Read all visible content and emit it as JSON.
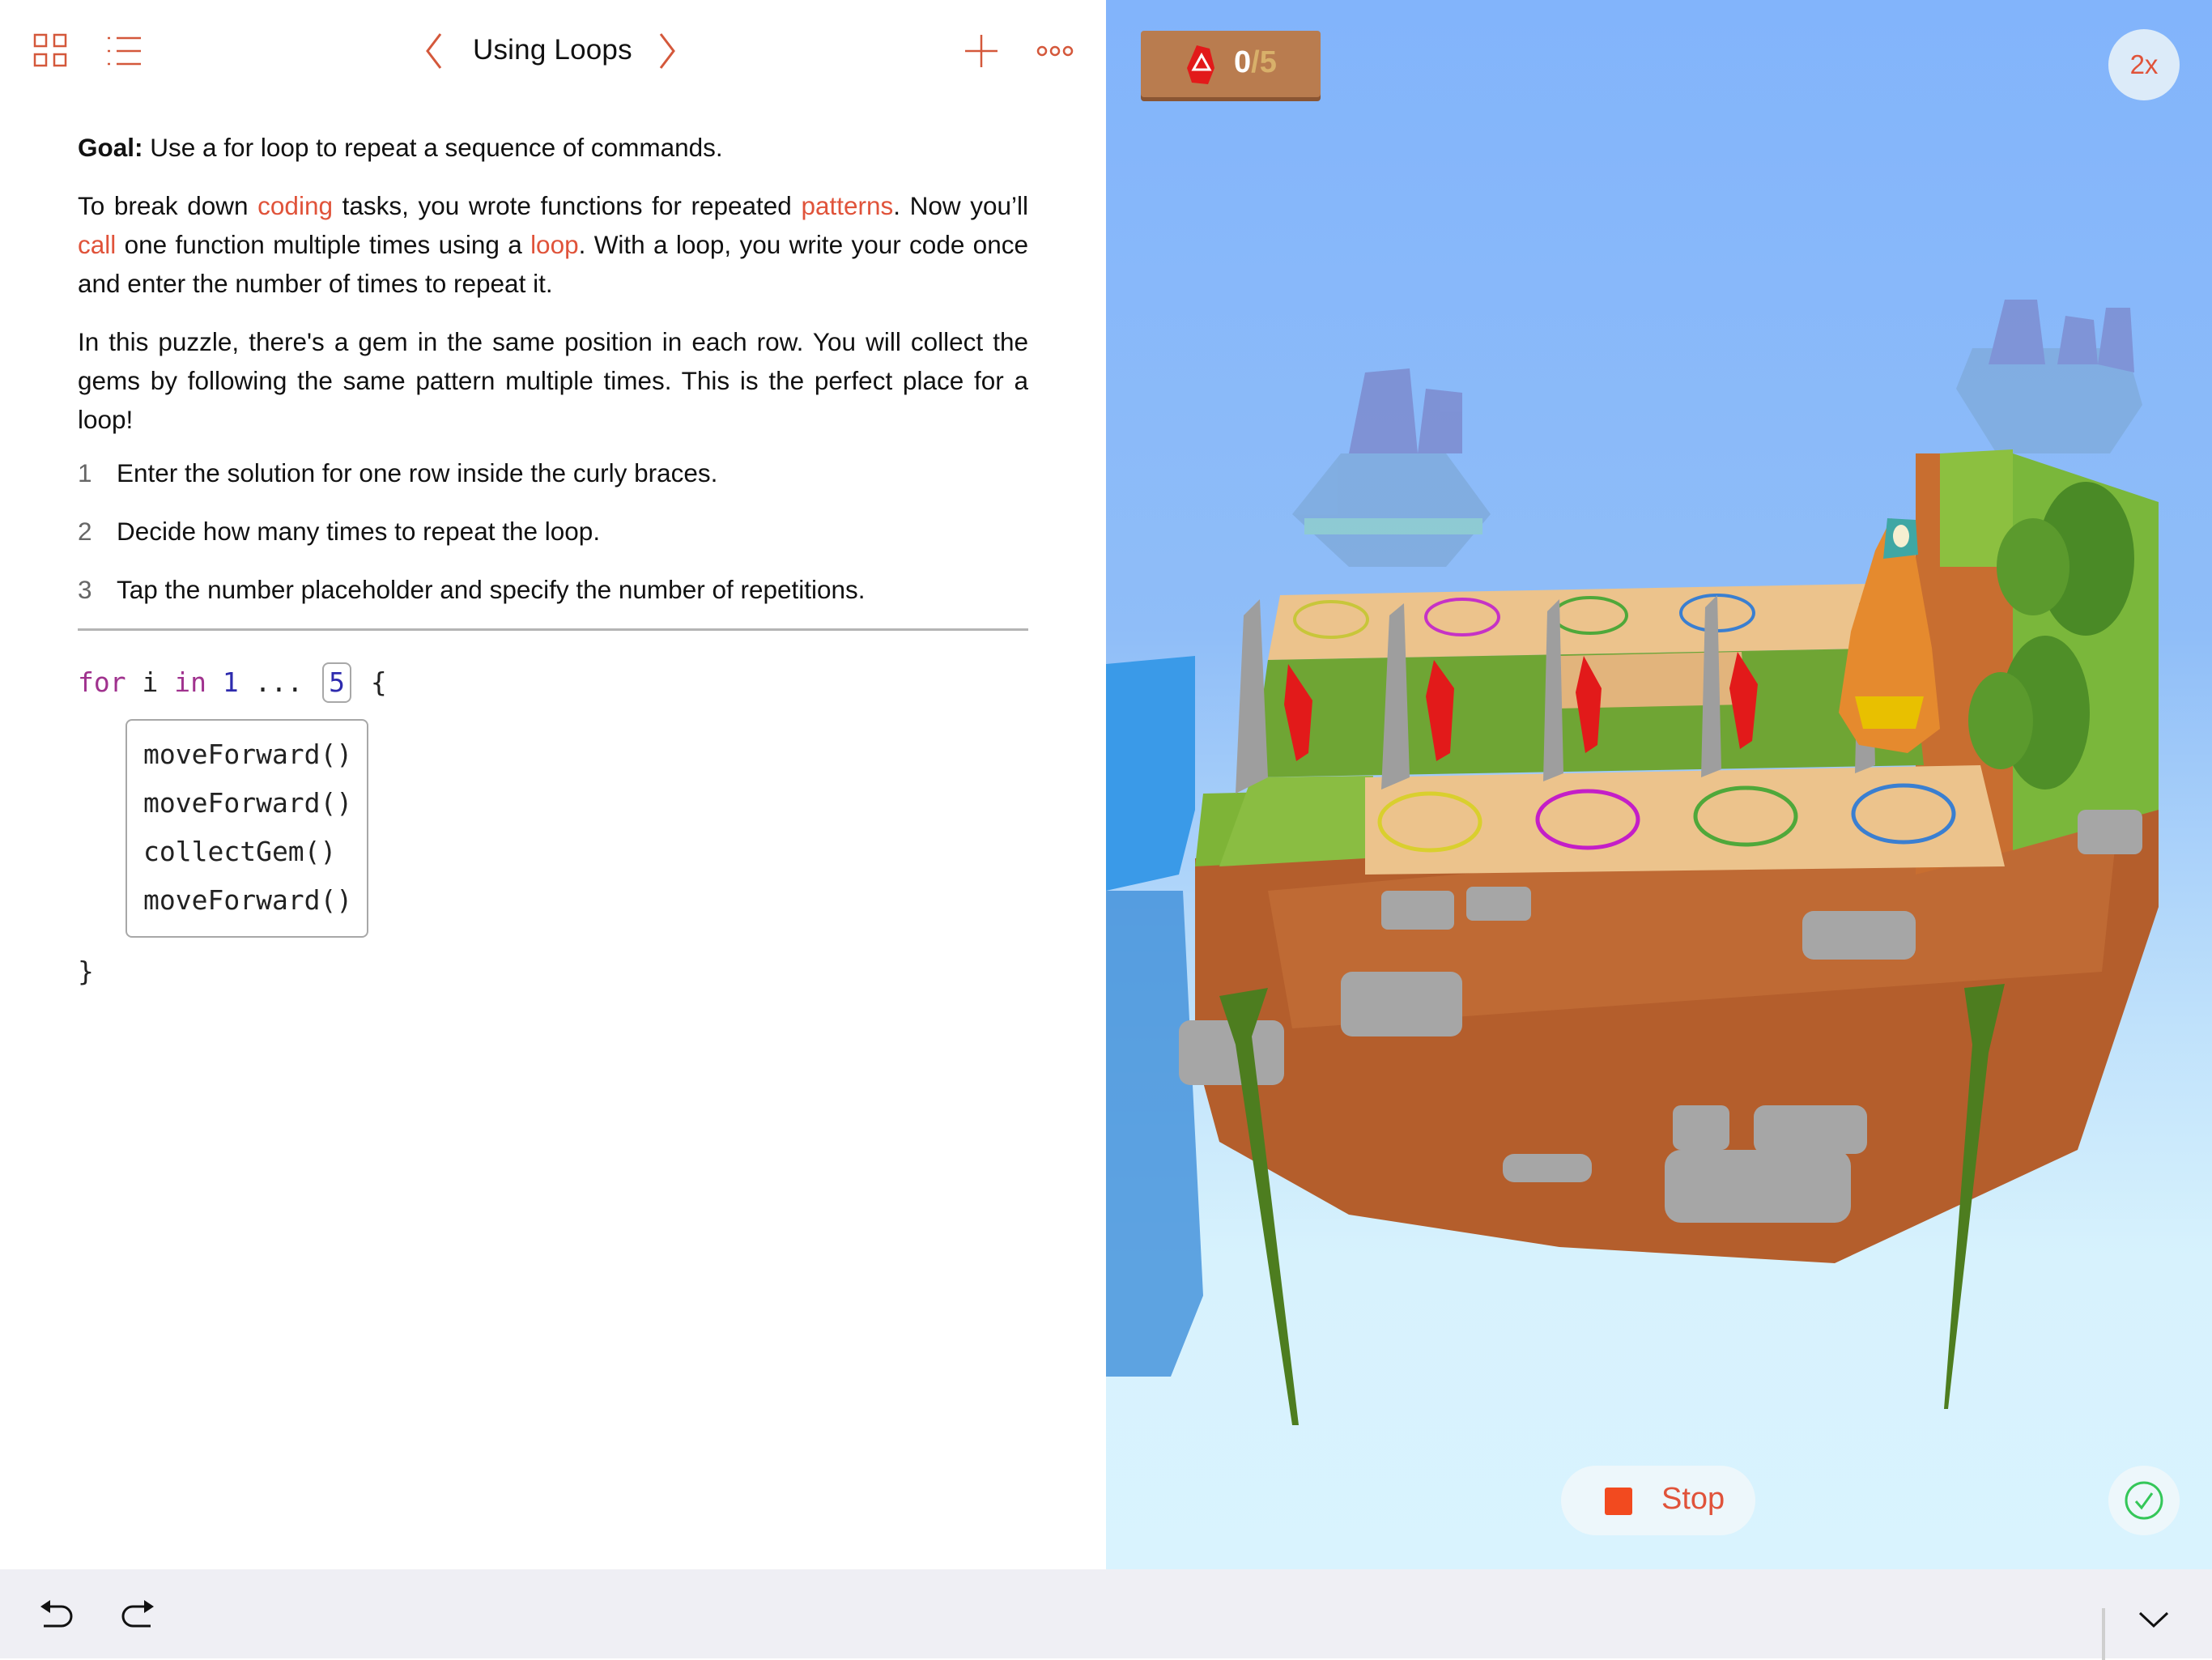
{
  "header": {
    "title": "Using Loops",
    "icons": [
      "grid-icon",
      "list-icon",
      "chevron-left-icon",
      "chevron-right-icon",
      "plus-icon",
      "more-icon"
    ]
  },
  "instructions": {
    "goal_label": "Goal:",
    "goal_text": " Use a for loop to repeat a sequence of commands.",
    "para1": [
      {
        "text": "To break down ",
        "link": false
      },
      {
        "text": "coding",
        "link": true
      },
      {
        "text": " tasks, you wrote functions for repeated ",
        "link": false
      },
      {
        "text": "patterns",
        "link": true
      },
      {
        "text": ". Now you’ll ",
        "link": false
      },
      {
        "text": "call",
        "link": true
      },
      {
        "text": " one function multiple times using a ",
        "link": false
      },
      {
        "text": "loop",
        "link": true
      },
      {
        "text": ". With a loop, you write your code once and enter the number of times to repeat it.",
        "link": false
      }
    ],
    "para2": "In this puzzle, there's a gem in the same position in each row. You will collect the gems by following the same pattern multiple times. This is the perfect place for a loop!",
    "steps": [
      {
        "num": "1",
        "text": "Enter the solution for one row inside the curly braces."
      },
      {
        "num": "2",
        "text": "Decide how many times to repeat the loop."
      },
      {
        "num": "3",
        "text": "Tap the number placeholder and specify the number of repetitions."
      }
    ]
  },
  "code": {
    "kw_for": "for",
    "var": "i",
    "kw_in": "in",
    "range_start": "1",
    "range_op": "...",
    "count": "5",
    "open_brace": "{",
    "body": [
      "moveForward()",
      "moveForward()",
      "collectGem()",
      "moveForward()"
    ],
    "close_brace": "}"
  },
  "game": {
    "gems_collected": "0",
    "gems_total": "/5",
    "speed_label": "2x",
    "stop_label": "Stop",
    "colors": {
      "accent": "#e0533a",
      "stop_red": "#f24a1f",
      "success_green": "#34c759",
      "sky_top": "#82b4fb",
      "sky_bottom": "#d9f3fe"
    }
  },
  "toolbar": {
    "icons": [
      "undo-icon",
      "redo-icon",
      "collapse-chevron-icon"
    ]
  }
}
